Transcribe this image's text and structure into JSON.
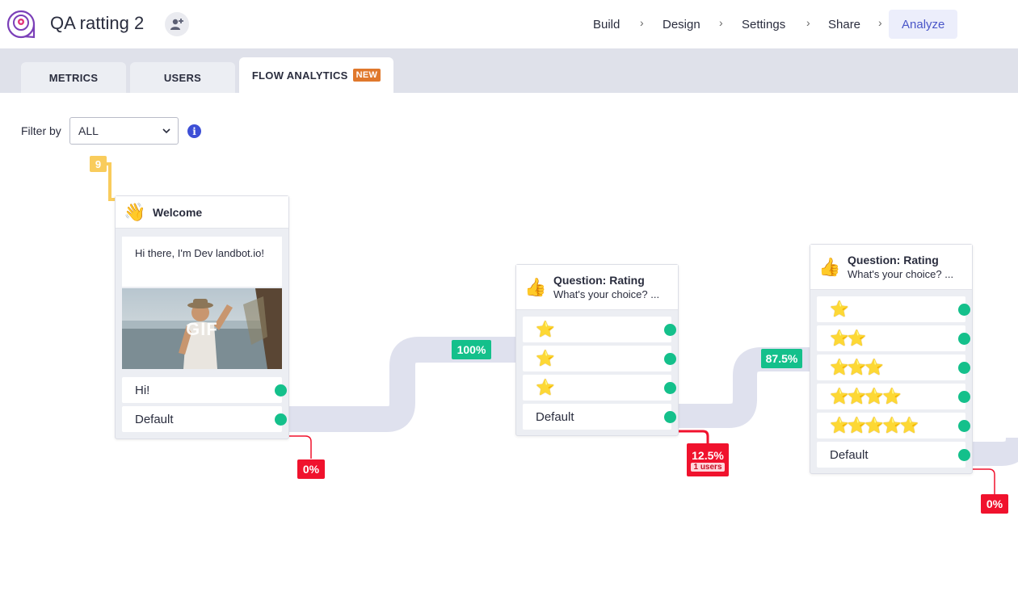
{
  "app": {
    "title": "QA ratting 2"
  },
  "nav": {
    "items": [
      "Build",
      "Design",
      "Settings",
      "Share",
      "Analyze"
    ],
    "separator": "›",
    "active": "Analyze"
  },
  "tabs": {
    "metrics": "METRICS",
    "users": "USERS",
    "flow": "FLOW ANALYTICS",
    "new_badge": "NEW"
  },
  "filter": {
    "label": "Filter by",
    "value": "ALL",
    "info": "i"
  },
  "flow": {
    "start_count": "9",
    "welcome": {
      "emoji": "👋",
      "title": "Welcome",
      "message": "Hi there, I'm Dev landbot.io!",
      "gif_label": "GIF",
      "buttons": [
        "Hi!",
        "Default"
      ],
      "drop_pct": "0%"
    },
    "rating1": {
      "emoji": "👍",
      "title": "Question: Rating",
      "subtitle": "What's your choice? ...",
      "options": [
        "⭐",
        "⭐",
        "⭐"
      ],
      "default_label": "Default",
      "in_pct": "100%",
      "drop_pct": "12.5%",
      "drop_users": "1 users"
    },
    "rating2": {
      "emoji": "👍",
      "title": "Question: Rating",
      "subtitle": "What's your choice? ...",
      "options": [
        "⭐",
        "⭐⭐",
        "⭐⭐⭐",
        "⭐⭐⭐⭐",
        "⭐⭐⭐⭐⭐"
      ],
      "default_label": "Default",
      "in_pct": "87.5%",
      "drop_pct": "0%"
    }
  },
  "colors": {
    "success": "#14c08b",
    "drop": "#f0122d",
    "path": "#dfe1ee",
    "start": "#f9cc5c",
    "accent": "#4a56c8"
  }
}
